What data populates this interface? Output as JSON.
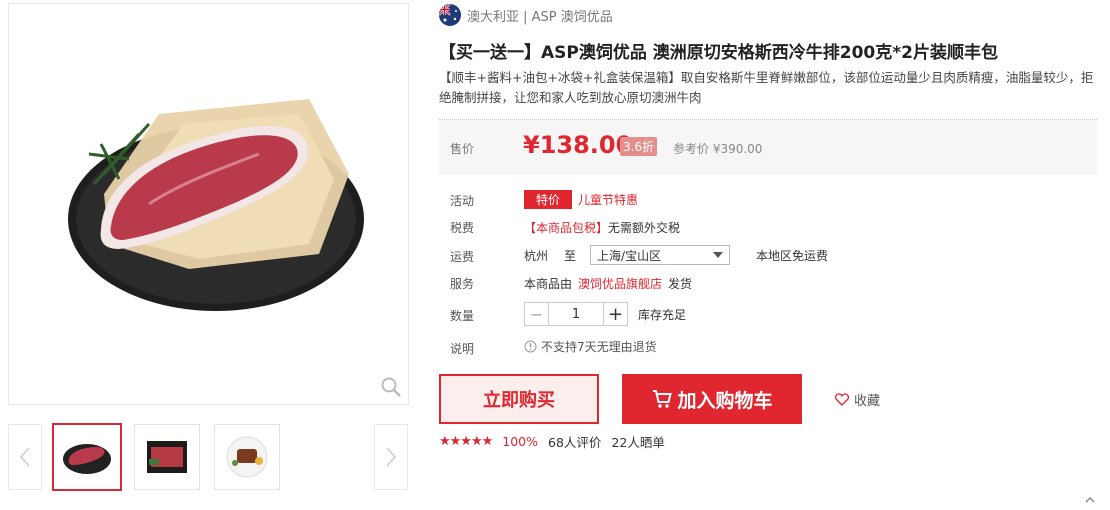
{
  "origin": {
    "flag_icon": "australia-flag-icon",
    "text": "澳大利亚 | ASP 澳饲优品"
  },
  "product": {
    "title": "【买一送一】ASP澳饲优品 澳洲原切安格斯西冷牛排200克*2片装顺丰包",
    "description": "【顺丰+酱料+油包+冰袋+礼盒装保温箱】取自安格斯牛里脊鲜嫩部位，该部位运动量少且肉质精瘦，油脂量较少，拒绝腌制拼接，让您和家人吃到放心原切澳洲牛肉"
  },
  "price": {
    "label": "售价",
    "value": "¥138.00",
    "discount": "3.6折",
    "reference": "参考价 ¥390.00"
  },
  "rows": {
    "promo": {
      "label": "活动",
      "tag": "特价",
      "text": "儿童节特惠"
    },
    "tax": {
      "label": "税费",
      "highlight": "【本商品包税】",
      "text": "无需额外交税"
    },
    "shipping": {
      "label": "运费",
      "from": "杭州",
      "to_word": "至",
      "destination": "上海/宝山区",
      "note": "本地区免运费"
    },
    "service": {
      "label": "服务",
      "prefix": "本商品由",
      "store": "澳饲优品旗舰店",
      "suffix": "发货"
    },
    "quantity": {
      "label": "数量",
      "value": "1",
      "stock": "库存充足"
    },
    "notice": {
      "label": "说明",
      "text": "不支持7天无理由退货"
    }
  },
  "actions": {
    "buy_now": "立即购买",
    "add_cart": "加入购物车",
    "favorite": "收藏"
  },
  "rating": {
    "stars": "★★★★★",
    "score": 5,
    "percent": "100%",
    "reviews": "68人评价",
    "photos": "22人晒单"
  },
  "colors": {
    "accent": "#e0262f",
    "price_bg": "#f6f6f6"
  },
  "gallery": {
    "thumbnails": [
      "steak-on-plate",
      "packaged-steak",
      "cooked-steak-dish"
    ],
    "active_index": 0
  }
}
